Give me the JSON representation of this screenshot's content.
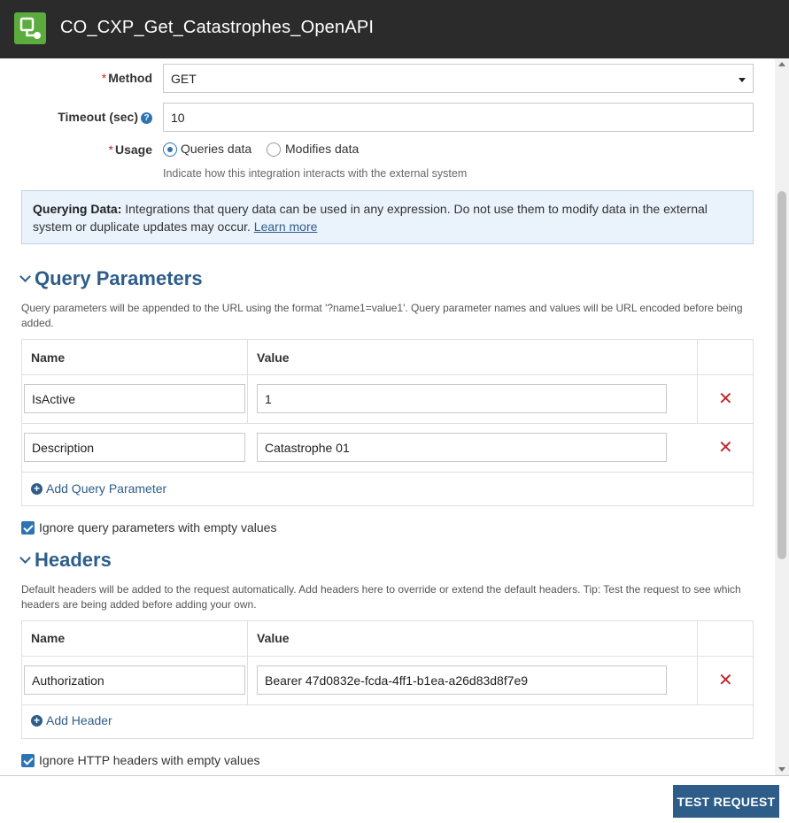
{
  "window": {
    "title": "CO_CXP_Get_Catastrophes_OpenAPI",
    "icon": "integration-icon"
  },
  "form": {
    "method": {
      "label": "Method",
      "value": "GET"
    },
    "timeout": {
      "label": "Timeout (sec)",
      "value": "10",
      "help": "?"
    },
    "usage": {
      "label": "Usage",
      "options": [
        "Queries data",
        "Modifies data"
      ],
      "selected": "Queries data",
      "hint": "Indicate how this integration interacts with the external system"
    }
  },
  "info_box": {
    "title": "Querying Data:",
    "text": "Integrations that query data can be used in any expression. Do not use them to modify data in the external system or duplicate updates may occur.",
    "link": "Learn more"
  },
  "query_parameters": {
    "heading": "Query Parameters",
    "description": "Query parameters will be appended to the URL using the format '?name1=value1'. Query parameter names and values will be URL encoded before being added.",
    "columns": [
      "Name",
      "Value"
    ],
    "rows": [
      {
        "name": "IsActive",
        "value": "1"
      },
      {
        "name": "Description",
        "value": "Catastrophe 01"
      }
    ],
    "add_label": "Add Query Parameter",
    "ignore_label": "Ignore query parameters with empty values"
  },
  "headers": {
    "heading": "Headers",
    "description": "Default headers will be added to the request automatically. Add headers here to override or extend the default headers. Tip: Test the request to see which headers are being added before adding your own.",
    "columns": [
      "Name",
      "Value"
    ],
    "rows": [
      {
        "name": "Authorization",
        "value": "Bearer 47d0832e-fcda-4ff1-b1ea-a26d83d8f7e9"
      }
    ],
    "add_label": "Add Header",
    "ignore_label": "Ignore HTTP headers with empty values"
  },
  "footer": {
    "test_label": "TEST REQUEST"
  },
  "colors": {
    "accent": "#2e5d8a",
    "delete": "#c2272d",
    "brand": "#5aad3c",
    "titlebar": "#2b2b2b"
  }
}
